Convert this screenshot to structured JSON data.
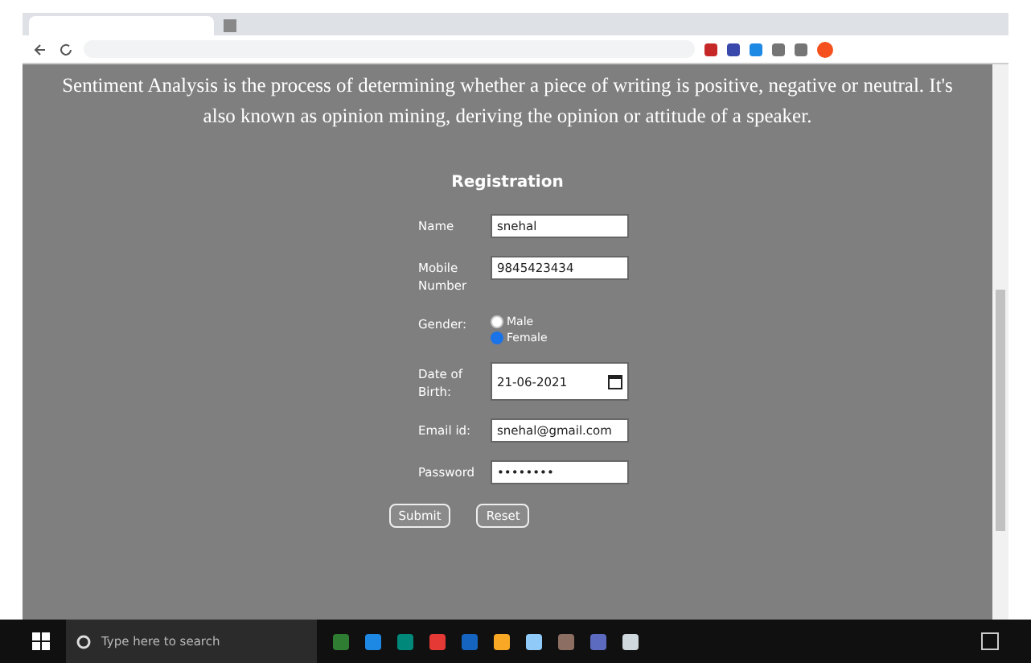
{
  "intro": "Sentiment Analysis is the process of determining whether a piece of writing is positive, negative or neutral. It's also known as opinion mining, deriving the opinion or attitude of a speaker.",
  "form": {
    "title": "Registration",
    "fields": [
      {
        "kind": "text",
        "label": "Name",
        "value": "snehal"
      },
      {
        "kind": "text",
        "label": "Mobile Number",
        "value": "9845423434"
      },
      {
        "kind": "radio",
        "label": "Gender:",
        "options": [
          {
            "label": "Male",
            "selected": false
          },
          {
            "label": "Female",
            "selected": true
          }
        ]
      },
      {
        "kind": "date",
        "label": "Date of Birth:",
        "value": "21-06-2021"
      },
      {
        "kind": "text",
        "label": "Email id:",
        "value": "snehal@gmail.com"
      },
      {
        "kind": "password",
        "label": "Password",
        "value": "••••••••"
      }
    ],
    "buttons": [
      "Submit",
      "Reset"
    ]
  },
  "taskbar": {
    "search_placeholder": "Type here to search"
  }
}
